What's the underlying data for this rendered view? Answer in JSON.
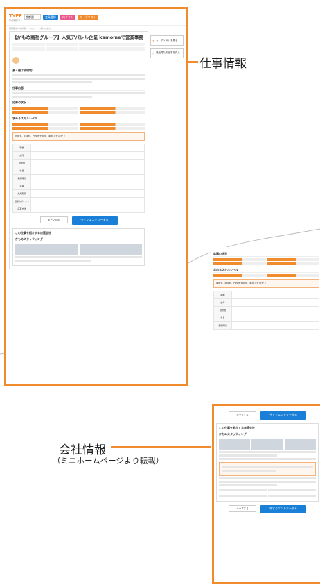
{
  "header": {
    "logo": "TYPE",
    "logo_sub": "求人情報サイト",
    "area_select": "首都圏",
    "links": [
      "会員登録",
      "ログイン",
      "キープリスト"
    ],
    "top_links": "首都圏求人の詳細 ／ ヘルプ ／ お問い合わせ"
  },
  "job": {
    "title": "【かもめ商社グループ】人気アパレル企業 kamomeで営業事務",
    "headline": "長く働ける環境！",
    "sections": [
      "仕事内容",
      "応募の状況",
      "求めるスキルレベル"
    ],
    "skills": [
      "Word",
      "Excel",
      "PowerPoint"
    ],
    "skill_note": "Word、Excel、PowerPoint、英語力を活かす",
    "table_keys": [
      "職種",
      "給与",
      "勤務地",
      "休日",
      "勤務時間",
      "待遇",
      "雇用形態",
      "選考のポイント",
      "応募方法"
    ],
    "cta_keep": "キープする",
    "cta_entry": "今すぐエントリーする",
    "company_section": "この仕事を紹介する派遣会社",
    "company_name": "かもめスタッフィング"
  },
  "sidebar": {
    "keep_label": "キープリストを見る",
    "history_label": "最近見たお仕事を見る"
  },
  "labels": {
    "job_info": "仕事情報",
    "company_info": "会社情報",
    "company_info_sub": "（ミニホームページより転載）"
  }
}
